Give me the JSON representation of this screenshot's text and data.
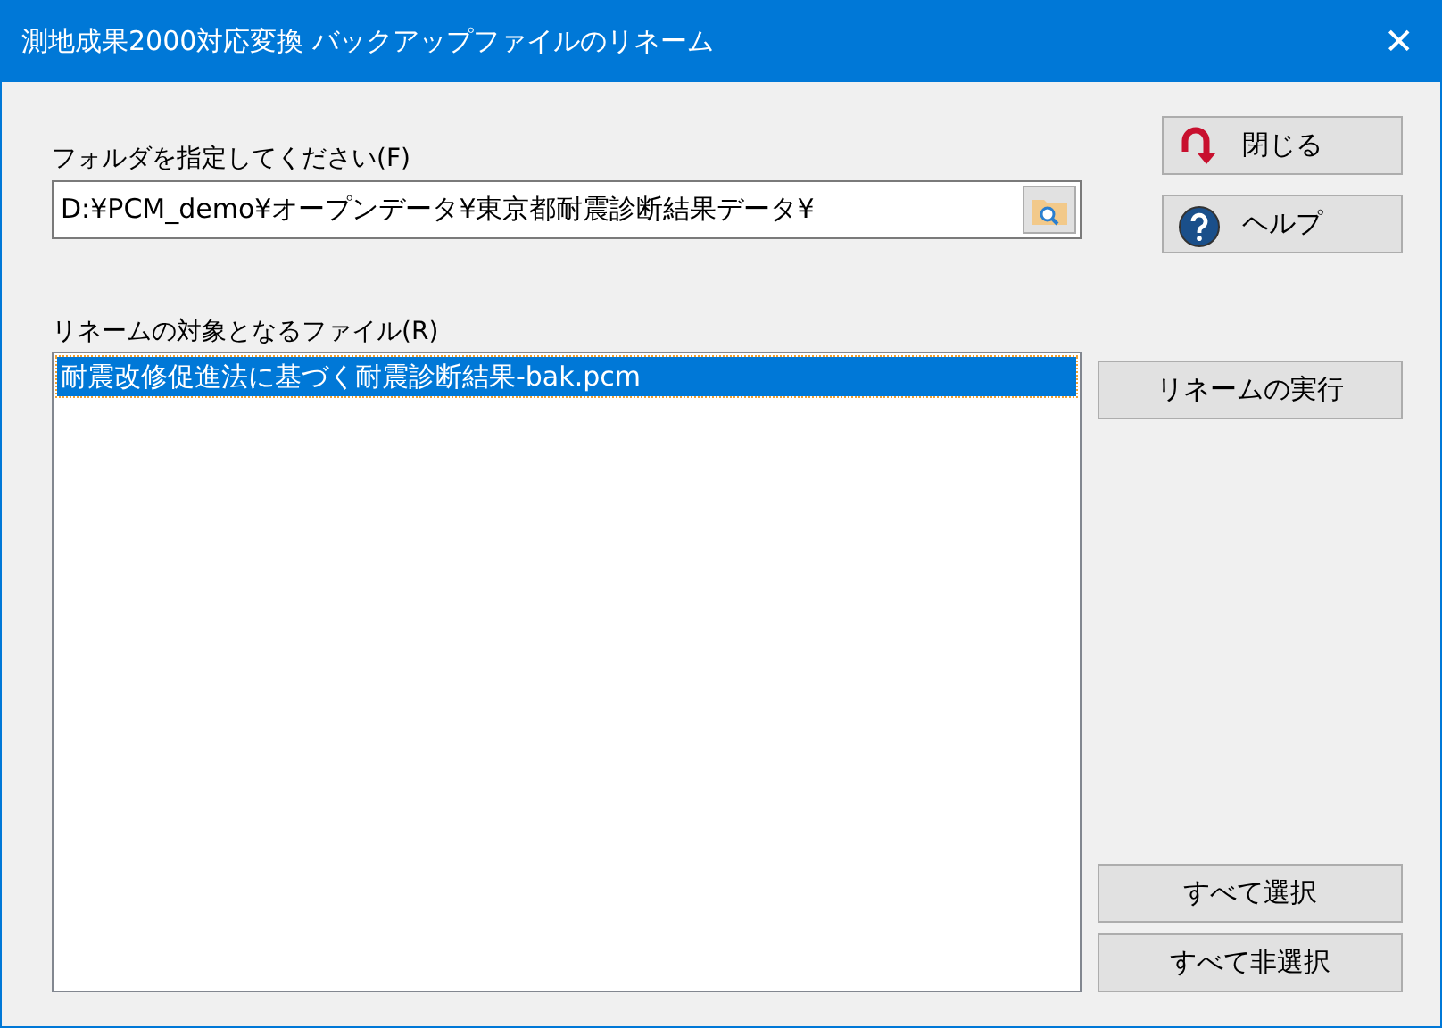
{
  "window": {
    "title": "測地成果2000対応変換 バックアップファイルのリネーム",
    "close": "✕"
  },
  "folder": {
    "label": "フォルダを指定してください(F)",
    "value": "D:¥PCM_demo¥オープンデータ¥東京都耐震診断結果データ¥"
  },
  "files": {
    "label": "リネームの対象となるファイル(R)",
    "items": [
      {
        "name": "耐震改修促進法に基づく耐震診断結果-bak.pcm",
        "selected": true
      }
    ]
  },
  "top_buttons": [
    {
      "kind": "close",
      "label": "閉じる"
    },
    {
      "kind": "help",
      "label": "ヘルプ"
    }
  ],
  "rename_button": "リネームの実行",
  "bottom_buttons": [
    "すべて選択",
    "すべて非選択"
  ]
}
